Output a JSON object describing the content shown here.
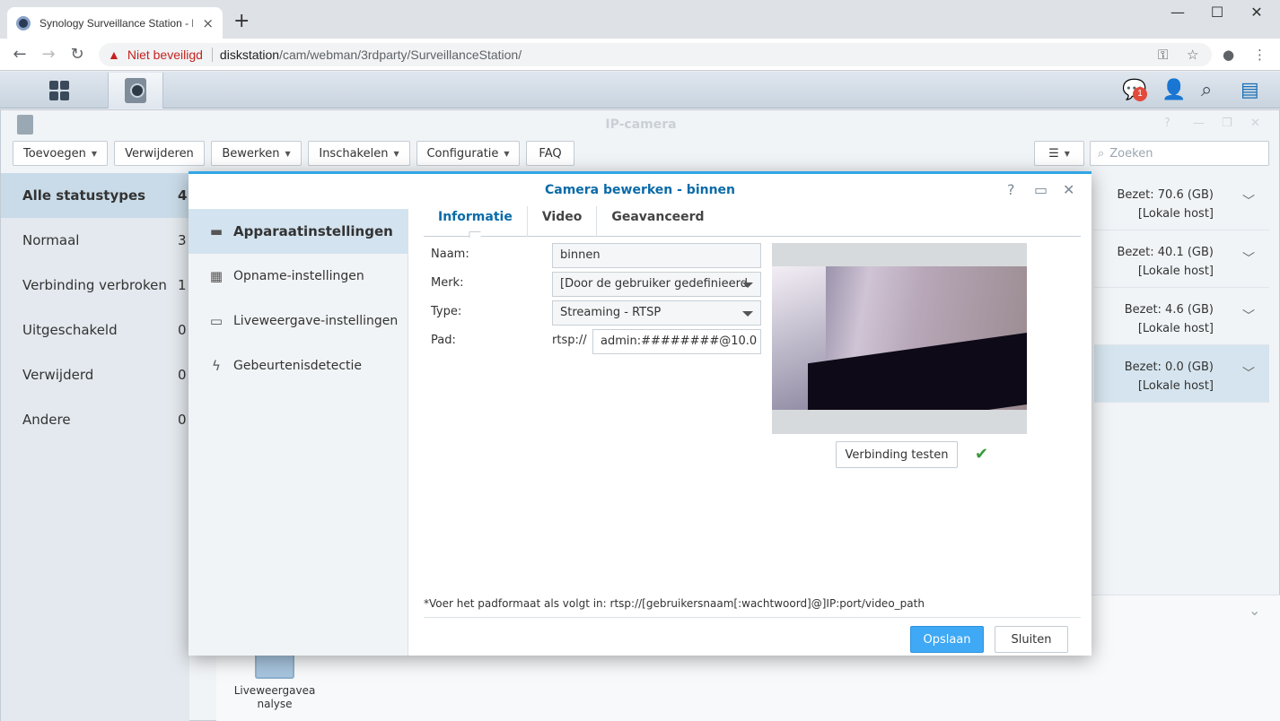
{
  "browser": {
    "tab_title": "Synology Surveillance Station - D",
    "tab_close": "×",
    "new_tab": "+",
    "window_controls": [
      "—",
      "☐",
      "✕"
    ],
    "security_warning": "Niet beveiligd",
    "url_host": "diskstation",
    "url_path": "/cam/webman/3rdparty/SurveillanceStation/"
  },
  "taskbar": {
    "notification_count": "1"
  },
  "app": {
    "title": "IP-camera",
    "toolbar": {
      "add": "Toevoegen",
      "remove": "Verwijderen",
      "edit": "Bewerken",
      "enable": "Inschakelen",
      "config": "Configuratie",
      "faq": "FAQ",
      "search_placeholder": "Zoeken"
    },
    "status_list": [
      {
        "label": "Alle statustypes",
        "count": "4"
      },
      {
        "label": "Normaal",
        "count": "3"
      },
      {
        "label": "Verbinding verbroken",
        "count": "1"
      },
      {
        "label": "Uitgeschakeld",
        "count": "0"
      },
      {
        "label": "Verwijderd",
        "count": "0"
      },
      {
        "label": "Andere",
        "count": "0"
      }
    ],
    "disk_rows": [
      {
        "used": "Bezet: 70.6 (GB)",
        "host": "[Lokale host]"
      },
      {
        "used": "Bezet: 40.1 (GB)",
        "host": "[Lokale host]"
      },
      {
        "used": "Bezet: 4.6 (GB)",
        "host": "[Lokale host]"
      },
      {
        "used": "Bezet: 0.0 (GB)",
        "host": "[Lokale host]"
      }
    ],
    "bottom_app_label": "Liveweergavea nalyse"
  },
  "dialog": {
    "title": "Camera bewerken - binnen",
    "side": [
      {
        "label": "Apparaatinstellingen"
      },
      {
        "label": "Opname-instellingen"
      },
      {
        "label": "Liveweergave-instellingen"
      },
      {
        "label": "Gebeurtenisdetectie"
      }
    ],
    "tabs": [
      "Informatie",
      "Video",
      "Geavanceerd"
    ],
    "form": {
      "name_label": "Naam:",
      "name_value": "binnen",
      "brand_label": "Merk:",
      "brand_value": "[Door de gebruiker gedefinieerd",
      "type_label": "Type:",
      "type_value": "Streaming - RTSP",
      "path_label": "Pad:",
      "path_prefix": "rtsp://",
      "path_value": "admin:########@10.0"
    },
    "test_button": "Verbinding testen",
    "hint": "*Voer het padformaat als volgt in: rtsp://[gebruikersnaam[:wachtwoord]@]IP:port/video_path",
    "save": "Opslaan",
    "close": "Sluiten"
  }
}
